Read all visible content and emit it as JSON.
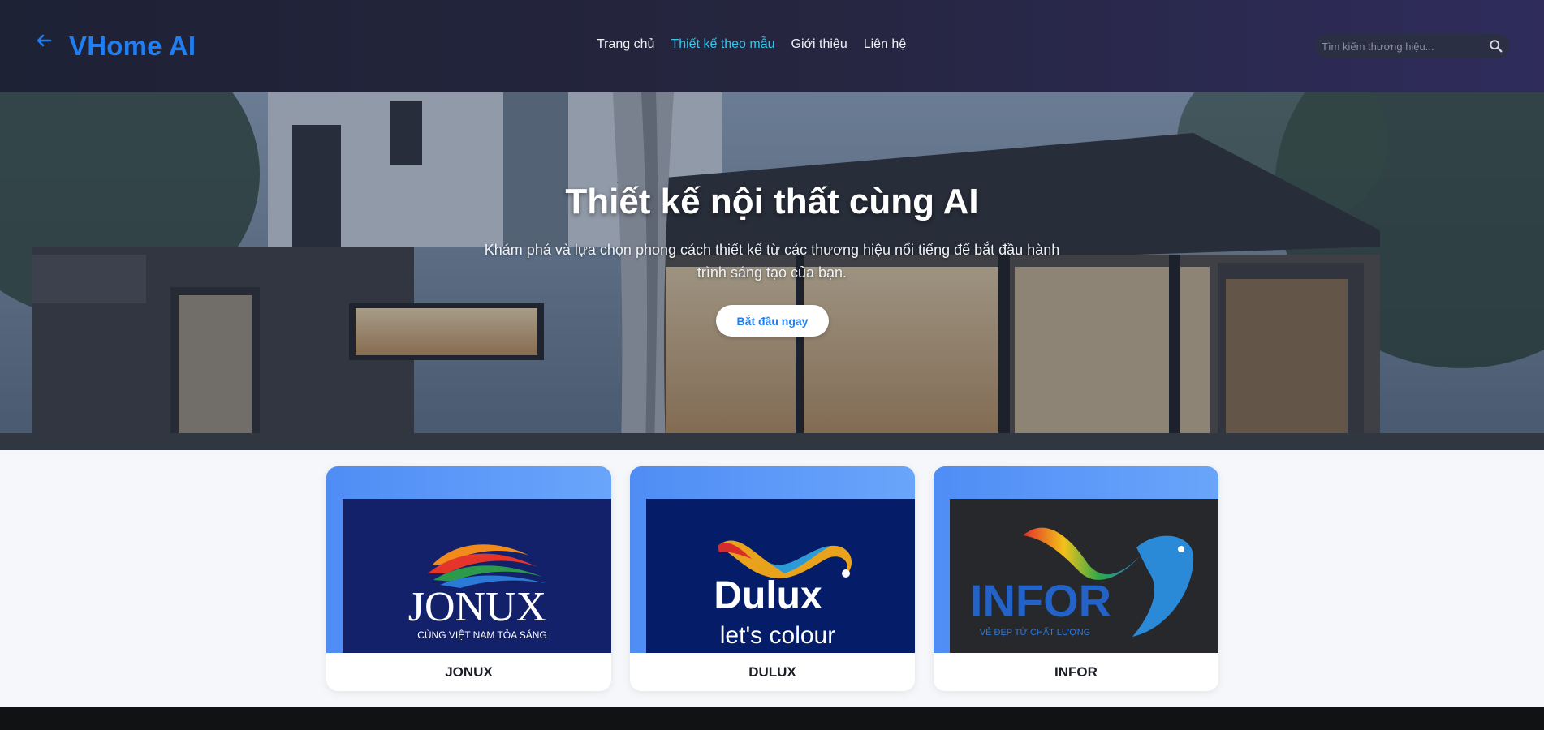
{
  "header": {
    "logo": "VHome AI",
    "nav": [
      {
        "label": "Trang chủ",
        "active": false
      },
      {
        "label": "Thiết kế theo mẫu",
        "active": true
      },
      {
        "label": "Giới thiệu",
        "active": false
      },
      {
        "label": "Liên hệ",
        "active": false
      }
    ],
    "search_placeholder": "Tìm kiếm thương hiệu...",
    "icons": {
      "back": "arrow-left-icon",
      "search": "search-icon"
    }
  },
  "hero": {
    "title": "Thiết kế nội thất cùng AI",
    "subtitle": "Khám phá và lựa chọn phong cách thiết kế từ các thương hiệu nổi tiếng để bắt đầu hành trình sáng tạo của bạn.",
    "button": "Bắt đầu ngay"
  },
  "brands": [
    {
      "name": "JONUX",
      "logo_text": "JONUX",
      "tagline": "CÙNG VIỆT NAM TỎA SÁNG"
    },
    {
      "name": "DULUX",
      "logo_text": "Dulux",
      "tagline": "let's colour"
    },
    {
      "name": "INFOR",
      "logo_text": "INFOR",
      "tagline": "VẺ ĐẸP TỪ CHẤT LƯỢNG"
    }
  ],
  "colors": {
    "accent": "#1f7ff2",
    "nav_active": "#2ec8f0",
    "header_bg": "#1e2235",
    "card_top": "#4f8df5"
  }
}
